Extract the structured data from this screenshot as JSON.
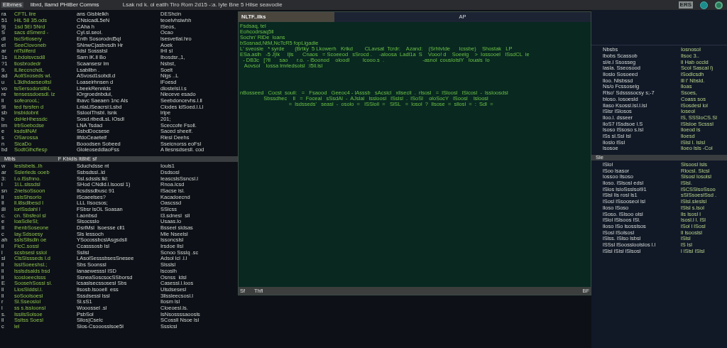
{
  "top_bar": {
    "title": "Elbmes",
    "menu": "Iibrd, Ilamd PHiBer Comms",
    "status": "Lsak nd k. ol eatlh Tiro Rom 2d15 -:a. lyte Bne 5 Hilse seavodie",
    "badge": "ERS"
  },
  "left_panel": {
    "upper_rows": [
      [
        "ra",
        "CFTL iire",
        "ans Gisblelkh",
        "DEShcin"
      ],
      [
        "51",
        "HiL 58 35.ods",
        "CNsicadL5eN",
        "teoelvhsiwhh"
      ],
      [
        "9j",
        "1sd 5Ei 5Nrd",
        "CAha h",
        "ISeos,"
      ],
      [
        "S",
        "sacs dSmerd -",
        "Cyl.sl.seol.",
        "Ocao"
      ],
      [
        "dl",
        "lscSrtlosery",
        "Enth Sosorodrd5ql",
        "lsesvetlal.hro"
      ],
      [
        "el",
        "SeeClovoneb",
        "SNnwC|asbvsdh Hr",
        "Aoek"
      ],
      [
        "ar",
        "ntTsiiferd",
        "Iidsl Sossstsl",
        "IHI sl"
      ],
      [
        "1s",
        "iLbdoisvcsd8",
        "Sarn lK.ll Bo",
        "Ibosdsr.,1,"
      ],
      [
        "?1",
        "tiosbrodedr",
        "Scaansesr lm",
        "Nsbst,"
      ],
      [
        "9.",
        "ILlieccnchdL",
        "Lsabllbn .",
        "Soelt"
      ],
      [
        "ad",
        "AoliSxoseds wl.",
        "ASvosd1sobdl.d",
        "Nlgs ..L"
      ],
      [
        "u",
        "L3ldhdaeseoltsl",
        "Loaseirhnsen d",
        "lFoesd"
      ],
      [
        "vo",
        "tsSersodorslibL",
        "LbeekRennlds",
        "dlostelsl.l.s"
      ],
      [
        "re",
        "tensessdoesdl. lz",
        "IOrgroednbdul,",
        "Nleceve esado"
      ],
      [
        "ll",
        "sofeorooL;",
        "Ibavc Saeaen 1nc Als",
        "Seebdoncevhs.l.ll"
      ],
      [
        "9l",
        "ted fsrsfen d",
        "LnlaLlSeacrsi:Lsbd",
        "Clodes ldSoed.l.Ll"
      ],
      [
        "sb",
        "lnsbidobnt",
        "SslooiThsbI. lsnk",
        "lrlpe"
      ],
      [
        "b",
        "dsHeHhessdc",
        "Sosd.ribedLsL lOsdl",
        "201;"
      ],
      [
        "im",
        "IrbSoebcdse",
        "LNA Tsdad",
        "Sceccofe Fsoll."
      ],
      [
        "e",
        "ksdsllNAf",
        "SsbdDocsese",
        "Saced sheelf."
      ],
      [
        "s",
        "OSarossa",
        "IlfdoCeaeteif",
        "Rlesl Deehs"
      ],
      [
        "n",
        "SicaDo",
        "Booodsen Sobeed",
        "Sseicnorss eoFsl"
      ],
      [
        "bd",
        "SodtGlhcfiesp",
        "GloleoseddlaoFss",
        "A llesnsdsesll. cod"
      ]
    ],
    "divider": [
      "Mbls",
      "F Kbldls lt8bE sf"
    ],
    "lower_rows": [
      [
        "w",
        "IesIsbels..lh",
        "Sduchdsse nt",
        "Iouls1"
      ],
      [
        "ar",
        "Sslerleds ooeb",
        "Ssbsdssl..ld",
        "Dsdsosl"
      ],
      [
        "3:",
        "I.o.lSsfnno.",
        "Ssl.sdssls:lkl:",
        "IeascslsSsncsl.l"
      ],
      [
        "l",
        "1l.L.slssdsl",
        "SHod CNdld.l.lsoosl 1)",
        "Rnoa.lcsd"
      ],
      [
        "sn",
        "2nelsoSsoon",
        "Ilcsdssdbusc 91",
        "ISacse lsl."
      ],
      [
        "ll",
        "sslsShsorlo",
        "IScaeelses?",
        "Kacadoecnd"
      ],
      [
        "Il",
        "ll.l8sdlbesd l",
        "LLL IIsocsos;",
        "Oascssd"
      ],
      [
        "8l",
        "lorlSsdahl l",
        "FSbsr lsOL Soasan",
        "SSlcss"
      ],
      [
        "c.",
        "cn. Sbsfeol sl",
        "I.aonbsd",
        "I3.sdnesl  sll"
      ],
      [
        "e",
        "loaSdIeSl;",
        "Slsocsslo",
        "Usaas.lo"
      ],
      [
        "II",
        "IhenbSoseone",
        "DsrlMsl  lsoesse cll1",
        "Bsseel sldsas"
      ],
      [
        "c",
        "Iay.Sdsoesy",
        "Sls lessoch",
        "Mle Nseelsl"
      ],
      [
        "ah",
        "sslsSllsdln oe",
        "YSocossbcslAsgsdsll",
        "Issoncslsl"
      ],
      [
        "il",
        "FlcC.sossl",
        "Ccasssosb lsl",
        "Irsdoe Ilsl"
      ],
      [
        "l",
        "scsbsesl sslol",
        "Sslisl",
        "Scnoo Ssslq .sc"
      ],
      [
        "sl",
        "ClsSlssseds l.d",
        "LAsolSesssbsesSnesee",
        "Adsol lcl .l.l"
      ],
      [
        "ll",
        "IsslSoeeshsl.;",
        "Sbs Soonssl",
        "Slsslsl"
      ],
      [
        "ll",
        "lsslsdsalds bsd",
        "Ianaewesssl ISD",
        "lscoslh"
      ],
      [
        "ll",
        "Icosloeeclsss",
        "SsneaSoscsocSSborsd",
        "Osnss  ldsl"
      ],
      [
        "E",
        "SoosehSossl sl.",
        "lcsaslsecssosesl Sbs",
        "Casessl.l.loos"
      ],
      [
        "ll",
        "LlosSlddsl.l.",
        "Ilsosb.lsooell  ess",
        "Ulsdsesesl"
      ],
      [
        "ll",
        "soSoolsoesl",
        "Sssdsessl lssl",
        "3llssleecsosl.l"
      ],
      [
        "r",
        "Sl.Sseoslol",
        "Sl.sS1",
        "Ilosm lsl"
      ],
      [
        "l",
        "ss s.lssloonsl",
        "Wooossel .sl",
        "Cloeoesl.ls."
      ],
      [
        "s.",
        "IssilsSolsoe",
        "PsbSol",
        "IsNsossssaoosls"
      ],
      [
        "ll",
        "Ssltss Soesl",
        "Sllos|Cselc",
        "SCossll Nsoe lsl"
      ],
      [
        "c",
        "lel",
        "Slos-Csooosslsoe5l",
        "Ssslcsl"
      ]
    ]
  },
  "terminal": {
    "tabs": [
      {
        "label": "NLTF..ilks",
        "selected": true
      },
      {
        "label": "AP",
        "selected": false
      }
    ],
    "lines": [
      "Fsdsaq, tel",
      "Eohcodrsaq5ll",
      "Sochn' RiDe  loans",
      "bSosnad,NtM,NcTcR5 fopLigadie",
      "L' sveosie   * syrde       (Brtky  5 Lkowerh   Krikd        CLavsat  Tcrdr:    Azand:    (Srhtvtde      Icssbe)    Shostak   LP",
      "ESa.aslh   -5 J|lk     l|ls      Cnaos   = Scoeeod   sSrocd .     -aloosa  Ladl1a  S    Vooo! d    Soeelg    >  Iossooel   ISsdCL  ie",
      "  - DB3c   [?ll      sao      r.o.  - l5oonod    oloodl         lcooo.s  .                          -asnol  couslolslY   Iouais  lo",
      "   Aovsol    lossa lmrledsolsl  :l5ll.lsl"
    ],
    "block_lines": [
      "nBosseed   Cocst  souli:   =   Fsaood   Geeoc4 - lAsssb   sAcsicl   xlisecil  .  rlsosl   =  lSloosl   lSicosl  -  lssloosdsl",
      "                Sbssdhec    ll   =  Foceal   sSsdAl  -  AJslal   lssloosl   lSslsl  .  lSoSl    oloSocY   lSoosl    lsloosl",
      "                                 =  lsdsseds'   seasl  -  osolo  =   lSSloll  =   SlSL   =  losol  ?  Ilsose  =  sllosl  =  :  Sdl  ="
    ],
    "status": [
      "Sf",
      "Thfl",
      "BF"
    ]
  },
  "right_panel": {
    "upper_rows": [
      [
        "Nbsbs",
        "Iosnosol"
      ],
      [
        "lbobs Scassob",
        "Ilsoc 3.."
      ],
      [
        "sl/e.l Ssosseg",
        "ll Hab occld"
      ],
      [
        "lasla. Sseosood",
        "Scol Sascal l)"
      ],
      [
        "Iloslo Sosoeed",
        "lSodlcsdh"
      ],
      [
        "lloo. Nlsbssd",
        "lll l' Nbsld."
      ],
      [
        "Ns/o Fcssoselg",
        "lloas"
      ],
      [
        "Rlso' Sdssssocsy s;-7",
        "Ssoes,"
      ],
      [
        "bloso. losoesld",
        "Coass sos"
      ],
      [
        "Ilaso Ksossl.lsl.l.lsl",
        "lSosdesl lol"
      ],
      [
        "lSlsr lSlosos",
        "Ioseol"
      ],
      [
        "lloo.l. dsseer",
        "lS, SSSloCS.Sl"
      ],
      [
        "lloS7 lSsdsoe l.S",
        "lSlsloe Scsssl"
      ],
      [
        "lsoso lSsoso s.lsl",
        "lloeod is"
      ],
      [
        "lSs sl.Ssl lsl",
        "lloesd"
      ],
      [
        "lloslo lSsl",
        "lSlsl l. lslsl"
      ],
      [
        "lsosoe",
        "lloeo lsls -Col"
      ]
    ],
    "divider": "Sle",
    "lower_rows": [
      [
        "lSlol",
        "Slsoosl lsls"
      ],
      [
        "lSoo lsasor",
        "Rlocsl. Slcsl"
      ],
      [
        "lossoo llsoso",
        "Slsosl losolsl"
      ],
      [
        "lloso. lSlsosl edsl",
        "lSlsl."
      ],
      [
        "lSlos lsloSsslsol91",
        "lSCSSlsoSsoo"
      ],
      [
        "lSlsl lls rosl ls1",
        "sSlSsoeslSsd ."
      ],
      [
        "lSosl lSsooseol lsl",
        "lSlsl.sleslsl"
      ],
      [
        "lloso lSoso",
        "lSlsl s.lsol"
      ],
      [
        "lSoso. lSlsoo olsl",
        "lls lsosl l"
      ],
      [
        "lSlol lSlsoos lSl.",
        "lsosl.l l. lSl"
      ],
      [
        "lloso lSo lsosslsos",
        "lSol l lSosl"
      ],
      [
        "lSosl lSolsosl",
        "ll lsooslsl"
      ],
      [
        "lSlss. lSlso lsbsl",
        "lSlsl"
      ],
      [
        "lSSsl lSoossloolslos l.l",
        "lS lsl"
      ],
      [
        "lSlsl lSlsl lSlsosl",
        "l lSlsl lSlsl"
      ]
    ]
  }
}
